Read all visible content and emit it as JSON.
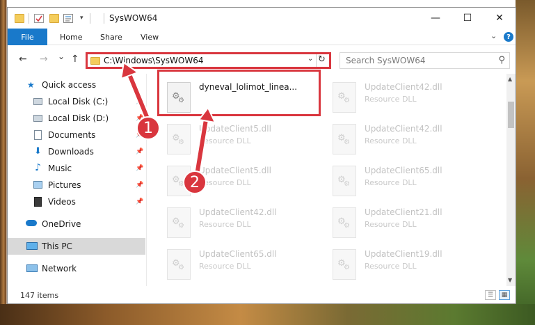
{
  "window": {
    "title": "SysWOW64",
    "controls": {
      "minimize": "—",
      "maximize": "☐",
      "close": "✕"
    }
  },
  "ribbon": {
    "tabs": [
      "File",
      "Home",
      "Share",
      "View"
    ],
    "expand_icon": "chevron-down-icon",
    "help": "?"
  },
  "navigation": {
    "back": "←",
    "forward": "→",
    "recent": "⌄",
    "up": "↑",
    "address": "C:\\Windows\\SysWOW64",
    "search_placeholder": "Search SysWOW64"
  },
  "sidebar": {
    "items": [
      {
        "label": "Quick access",
        "icon": "star-icon",
        "pinned": false,
        "selected": false
      },
      {
        "label": "Local Disk (C:)",
        "icon": "drive-icon",
        "pinned": true,
        "selected": false
      },
      {
        "label": "Local Disk (D:)",
        "icon": "drive-icon",
        "pinned": true,
        "selected": false
      },
      {
        "label": "Documents",
        "icon": "documents-icon",
        "pinned": true,
        "selected": false
      },
      {
        "label": "Downloads",
        "icon": "downloads-icon",
        "pinned": true,
        "selected": false
      },
      {
        "label": "Music",
        "icon": "music-icon",
        "pinned": true,
        "selected": false
      },
      {
        "label": "Pictures",
        "icon": "pictures-icon",
        "pinned": true,
        "selected": false
      },
      {
        "label": "Videos",
        "icon": "videos-icon",
        "pinned": true,
        "selected": false
      },
      {
        "label": "OneDrive",
        "icon": "cloud-icon",
        "pinned": false,
        "selected": false
      },
      {
        "label": "This PC",
        "icon": "computer-icon",
        "pinned": false,
        "selected": true
      },
      {
        "label": "Network",
        "icon": "network-icon",
        "pinned": false,
        "selected": false
      }
    ]
  },
  "files": {
    "left_column": [
      {
        "name": "dyneval_lolimot_linea...",
        "type": "",
        "highlighted": true
      },
      {
        "name": "UpdateClient5.dll",
        "type": "Resource DLL",
        "highlighted": false
      },
      {
        "name": "UpdateClient5.dll",
        "type": "Resource DLL",
        "highlighted": false
      },
      {
        "name": "UpdateClient42.dll",
        "type": "Resource DLL",
        "highlighted": false
      },
      {
        "name": "UpdateClient65.dll",
        "type": "Resource DLL",
        "highlighted": false
      }
    ],
    "right_column": [
      {
        "name": "UpdateClient42.dll",
        "type": "Resource DLL"
      },
      {
        "name": "UpdateClient42.dll",
        "type": "Resource DLL"
      },
      {
        "name": "UpdateClient65.dll",
        "type": "Resource DLL"
      },
      {
        "name": "UpdateClient21.dll",
        "type": "Resource DLL"
      },
      {
        "name": "UpdateClient19.dll",
        "type": "Resource DLL"
      }
    ]
  },
  "status": {
    "item_count": "147 items"
  },
  "annotations": {
    "step1": "1",
    "step2": "2",
    "color": "#d9363e"
  },
  "colors": {
    "accent": "#1979ca",
    "highlight": "#d9363e",
    "selected_row": "#d9d9d9"
  }
}
